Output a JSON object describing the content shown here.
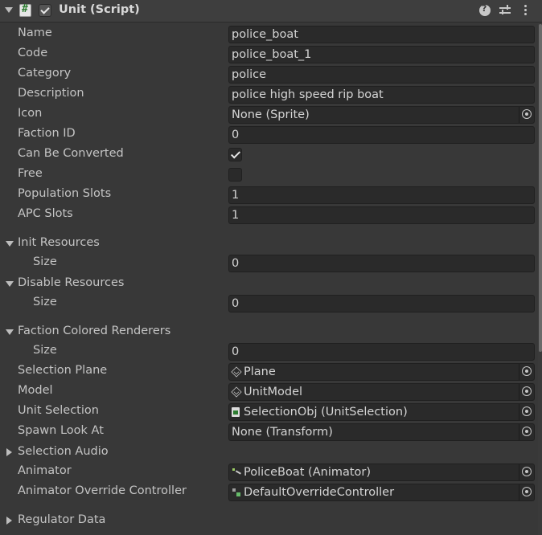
{
  "header": {
    "title": "Unit (Script)",
    "enabled": true,
    "icons": [
      "fold-arrow-icon",
      "script-icon",
      "help-icon",
      "preset-icon",
      "kebab-menu-icon"
    ]
  },
  "fields": [
    {
      "label": "Name",
      "type": "text",
      "value": "police_boat"
    },
    {
      "label": "Code",
      "type": "text",
      "value": "police_boat_1"
    },
    {
      "label": "Category",
      "type": "text",
      "value": "police"
    },
    {
      "label": "Description",
      "type": "text",
      "value": "police high speed rip boat"
    },
    {
      "label": "Icon",
      "type": "object",
      "value": "None (Sprite)"
    },
    {
      "label": "Faction ID",
      "type": "number",
      "value": "0"
    },
    {
      "label": "Can Be Converted",
      "type": "toggle",
      "checked": true
    },
    {
      "label": "Free",
      "type": "toggle",
      "checked": false
    },
    {
      "label": "Population Slots",
      "type": "number",
      "value": "1"
    },
    {
      "label": "APC Slots",
      "type": "number",
      "value": "1"
    },
    {
      "label": "Init Resources",
      "type": "foldout",
      "expanded": true
    },
    {
      "label": "Size",
      "type": "number",
      "value": "0",
      "indent": 1
    },
    {
      "label": "Disable Resources",
      "type": "foldout",
      "expanded": true
    },
    {
      "label": "Size",
      "type": "number",
      "value": "0",
      "indent": 1
    },
    {
      "label": "Faction Colored Renderers",
      "type": "foldout",
      "expanded": true
    },
    {
      "label": "Size",
      "type": "number",
      "value": "0",
      "indent": 1
    },
    {
      "label": "Selection Plane",
      "type": "object",
      "value": "Plane",
      "icon": "cube-icon"
    },
    {
      "label": "Model",
      "type": "object",
      "value": "UnitModel",
      "icon": "cube-icon"
    },
    {
      "label": "Unit Selection",
      "type": "object",
      "value": "SelectionObj (UnitSelection)",
      "icon": "script-file-icon"
    },
    {
      "label": "Spawn Look At",
      "type": "object",
      "value": "None (Transform)"
    },
    {
      "label": "Selection Audio",
      "type": "foldout",
      "expanded": false
    },
    {
      "label": "Animator",
      "type": "object",
      "value": "PoliceBoat (Animator)",
      "icon": "animator-icon"
    },
    {
      "label": "Animator Override Controller",
      "type": "object",
      "value": "DefaultOverrideController",
      "icon": "override-controller-icon"
    },
    {
      "label": "Regulator Data",
      "type": "foldout",
      "expanded": false
    }
  ]
}
